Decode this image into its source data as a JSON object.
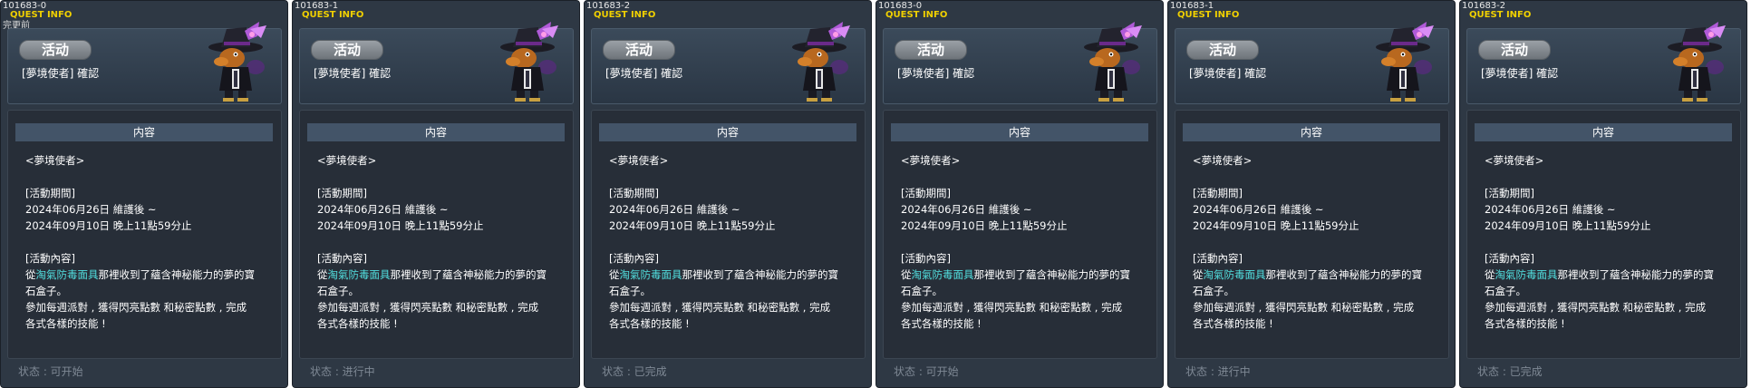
{
  "panels": [
    {
      "id": "101683-0",
      "sub": "完更前",
      "footer": "状态 : 可开始"
    },
    {
      "id": "101683-1",
      "sub": "",
      "footer": "状态 : 进行中"
    },
    {
      "id": "101683-2",
      "sub": "",
      "footer": "状态 : 已完成"
    },
    {
      "id": "101683-0",
      "sub": "",
      "footer": "状态 : 可开始"
    },
    {
      "id": "101683-1",
      "sub": "",
      "footer": "状态 : 进行中"
    },
    {
      "id": "101683-2",
      "sub": "",
      "footer": "状态 : 已完成"
    }
  ],
  "common": {
    "quest_info_label": "QUEST INFO",
    "status_button": "活动",
    "quest_name": "[夢境使者] 確認",
    "content_title": "内容",
    "line_npc": "<夢境使者>",
    "line_period_label": "[活動期間]",
    "line_period_1": "2024年06月26日 維護後 ~",
    "line_period_2": "2024年09月10日 晚上11點59分止",
    "line_content_label": "[活動內容]",
    "line_from": "從",
    "highlight_item": "淘氣防毒面具",
    "line_rest1": "那裡收到了蘊含神秘能力的夢的寶",
    "line_rest2": "石盒子。",
    "line_rest3": "參加每週派對 , 獲得閃亮點數 和秘密點數 , 完成",
    "line_rest4": "各式各樣的技能 !"
  },
  "colors": {
    "panel_bg": "#2e3844",
    "accent_yellow": "#f0d000",
    "highlight_cyan": "#52e0e0",
    "title_bar": "#435468"
  },
  "icons": {
    "npc": "dream-messenger-npc-icon"
  }
}
